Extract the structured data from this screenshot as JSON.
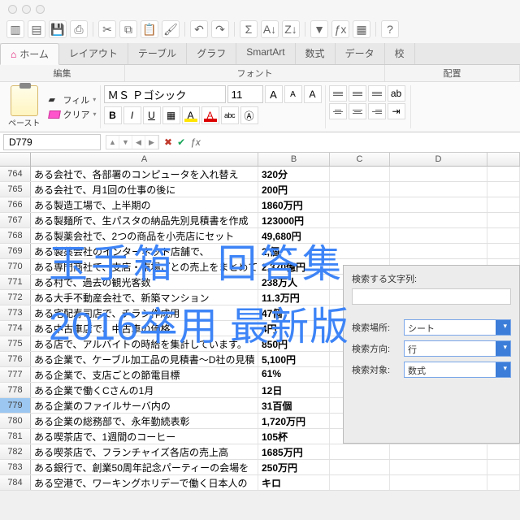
{
  "tabs": [
    "ホーム",
    "レイアウト",
    "テーブル",
    "グラフ",
    "SmartArt",
    "数式",
    "データ",
    "校"
  ],
  "groups": {
    "edit": "編集",
    "font": "フォント",
    "align": "配置"
  },
  "ribbon": {
    "paste": "ペースト",
    "fill": "フィル",
    "clear": "クリア",
    "font_name": "ＭＳ Ｐゴシック",
    "font_size": "11"
  },
  "btn": {
    "B": "B",
    "I": "I",
    "U": "U",
    "abc": "abc",
    "A": "A",
    "Aa": "A",
    "down": "▾"
  },
  "namebox": "D779",
  "cols": [
    "A",
    "B",
    "C",
    "D"
  ],
  "rows": [
    {
      "n": 764,
      "a": "ある会社で、各部署のコンピュータを入れ替え",
      "b": "320分"
    },
    {
      "n": 765,
      "a": "ある会社で、月1回の仕事の後に",
      "b": "200円"
    },
    {
      "n": 766,
      "a": "ある製造工場で、上半期の",
      "b": "1860万円"
    },
    {
      "n": 767,
      "a": "ある製麺所で、生パスタの納品先別見積書を作成",
      "b": "123000円"
    },
    {
      "n": 768,
      "a": "ある製薬会社で、2つの商品を小売店にセット",
      "b": "49,680円"
    },
    {
      "n": 769,
      "a": "ある製薬会社のインターネット店舗で、",
      "b": "2,個"
    },
    {
      "n": 770,
      "a": "ある専門商社で、支店・市場ごとの売上をまとめています",
      "b": "2,370億円"
    },
    {
      "n": 771,
      "a": "ある村で、過去の観光客数",
      "b": "238万人"
    },
    {
      "n": 772,
      "a": "ある大手不動産会社で、新築マンション",
      "b": "11.3万円"
    },
    {
      "n": 773,
      "a": "ある宅配寿司店で、チラシ作成用",
      "b": "47個"
    },
    {
      "n": 774,
      "a": "ある中古車店で、中古車の価格",
      "b": "4円"
    },
    {
      "n": 775,
      "a": "ある店で、アルバイトの時給を集計しています。",
      "b": "850円"
    },
    {
      "n": 776,
      "a": "ある企業で、ケーブル加工品の見積書〜D社の見積",
      "b": "5,100円"
    },
    {
      "n": 777,
      "a": "ある企業で、支店ごとの節電目標",
      "b": "61%"
    },
    {
      "n": 778,
      "a": "ある企業で働くCさんの1月",
      "b": "12日"
    },
    {
      "n": 779,
      "a": "ある企業のファイルサーバ内の",
      "b": "31百個"
    },
    {
      "n": 780,
      "a": "ある企業の総務部で、永年勤続表彰",
      "b": "1,720万円"
    },
    {
      "n": 781,
      "a": "ある喫茶店で、1週間のコーヒー",
      "b": "105杯"
    },
    {
      "n": 782,
      "a": "ある喫茶店で、フランチャイズ各店の売上高",
      "b": "1685万円"
    },
    {
      "n": 783,
      "a": "ある銀行で、創業50周年記念パーティーの会場を",
      "b": "250万円"
    },
    {
      "n": 784,
      "a": "ある空港で、ワーキングホリデーで働く日本人の",
      "b": "キロ"
    }
  ],
  "selected_row": 779,
  "find": {
    "label": "検索する文字列:",
    "place_lbl": "検索場所:",
    "place_val": "シート",
    "dir_lbl": "検索方向:",
    "dir_val": "行",
    "target_lbl": "検索対象:",
    "target_val": "数式"
  },
  "overlay": {
    "l1": "玉手箱　回答集",
    "l2": "2016卒用 最新版"
  },
  "fx": "ƒx"
}
